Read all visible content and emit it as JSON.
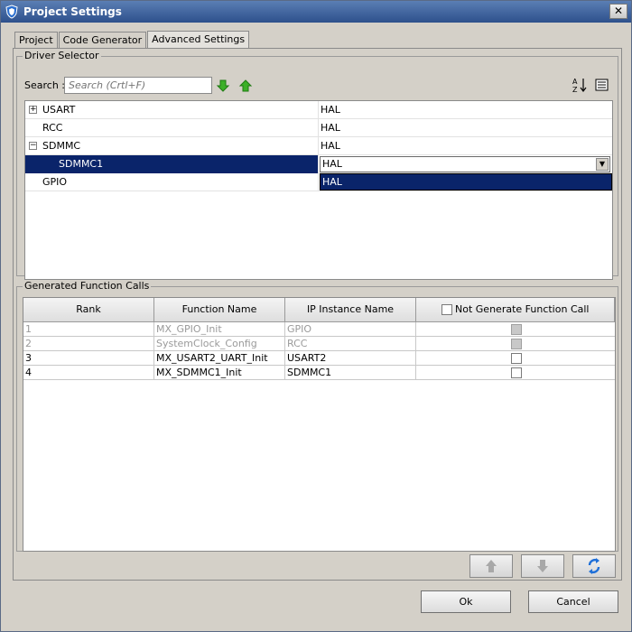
{
  "window": {
    "title": "Project Settings",
    "close_glyph": "✕"
  },
  "tabs": [
    {
      "label": "Project",
      "active": false
    },
    {
      "label": "Code Generator",
      "active": false
    },
    {
      "label": "Advanced Settings",
      "active": true
    }
  ],
  "driver_selector": {
    "title": "Driver Selector",
    "search_label": "Search :",
    "search_placeholder": "Search (Crtl+F)",
    "rows": [
      {
        "name": "USART",
        "value": "HAL",
        "expander": "+"
      },
      {
        "name": "RCC",
        "value": "HAL",
        "expander": ""
      },
      {
        "name": "SDMMC",
        "value": "HAL",
        "expander": "−"
      },
      {
        "name": "SDMMC1",
        "value": "HAL",
        "expander": "",
        "selected": true
      },
      {
        "name": "GPIO",
        "value": "",
        "expander": ""
      }
    ],
    "dropdown_option": "HAL",
    "combo_arrow": "▼"
  },
  "generated_calls": {
    "title": "Generated Function Calls",
    "headers": {
      "rank": "Rank",
      "function_name": "Function Name",
      "ip_instance": "IP Instance Name",
      "not_generate": "Not Generate Function Call"
    },
    "rows": [
      {
        "rank": "1",
        "function": "MX_GPIO_Init",
        "ip": "GPIO",
        "disabled": true
      },
      {
        "rank": "2",
        "function": "SystemClock_Config",
        "ip": "RCC",
        "disabled": true
      },
      {
        "rank": "3",
        "function": "MX_USART2_UART_Init",
        "ip": "USART2",
        "disabled": false
      },
      {
        "rank": "4",
        "function": "MX_SDMMC1_Init",
        "ip": "SDMMC1",
        "disabled": false
      }
    ]
  },
  "buttons": {
    "ok": "Ok",
    "cancel": "Cancel"
  },
  "colors": {
    "selection": "#0a246a",
    "accent_green": "#3cb028",
    "refresh_blue": "#1e6fd8"
  }
}
